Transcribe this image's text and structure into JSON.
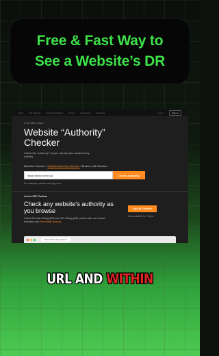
{
  "headline": {
    "line1": "Free & Fast Way to",
    "line2": "See a Website’s DR",
    "color": "#3ee34a"
  },
  "screenshot": {
    "nav": [
      "Tools",
      "Site Explorer",
      "Keywords Explorer",
      "Pricing",
      "Resources",
      "Enterprise"
    ],
    "nav_right": [
      "Log in",
      "Sign up"
    ],
    "breadcrumb": "Free SEO Tools /",
    "title_line1": "Website “Authority”",
    "title_line2": "Checker",
    "description": "Check the \"authority\" of your domain (as measured by Ahrefs).",
    "links": {
      "backlink": "Backlink Checker /",
      "authority": "Website Authority Checker",
      "broken": "/ Broken Link Checker"
    },
    "input_value": "https://www.mzee.pk/",
    "check_button": "Check Authority",
    "example": "For example, ahrefs.com yep.com",
    "promo": {
      "kicker": "Ahrefs SEO Toolbar",
      "title": "Check any website’s authority as you browse",
      "desc_prefix": "Unlock Domain Rating (DR) and URL Rating (UR) metrics with our browser extension and",
      "desc_link": "free Ahrefs account.",
      "chrome_button": "Add to Chrome",
      "also_prefix": "Also available for",
      "also_browser": "Firefox."
    },
    "mini_tab": "Ahrefs Marketing Platform",
    "accent": "#ff8a1f"
  },
  "caption": {
    "word1": "URL AND",
    "word2": "WITHIN"
  }
}
